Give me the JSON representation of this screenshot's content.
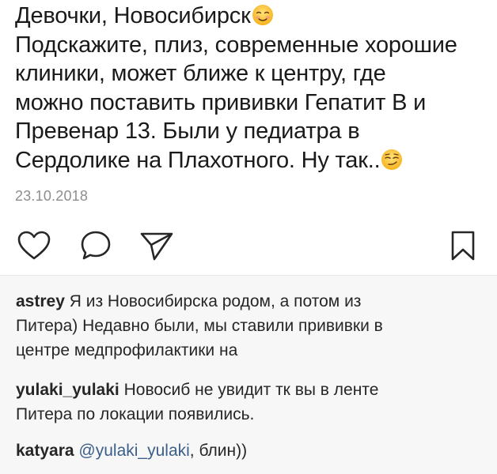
{
  "post": {
    "lines": [
      "Девочки, Новосибирск",
      "Подскажите, плиз, современные хорошие",
      "клиники, может ближе к центру, где",
      "можно поставить прививки Гепатит В и",
      "Превенар 13. Были у педиатра в",
      "Сердолике на Плахотного. Ну так.."
    ],
    "emoji_1": "smiling-face-with-blush",
    "emoji_2": "smirking-face",
    "date": "23.10.2018"
  },
  "actions": {
    "like_icon": "heart-icon",
    "comment_icon": "comment-bubble-icon",
    "share_icon": "paper-plane-icon",
    "save_icon": "bookmark-icon"
  },
  "comments": [
    {
      "username": "astrey",
      "lines": [
        "Я из Новосибирска родом, а потом из",
        "Питера) Недавно были, мы ставили прививки в",
        "центре медпрофилактики на"
      ]
    },
    {
      "username": "yulaki_yulaki",
      "lines": [
        "Новосиб не увидит тк вы в ленте",
        "Питера по локации появились."
      ]
    },
    {
      "username": "katyara",
      "mention": "@yulaki_yulaki",
      "rest": ", блин))"
    }
  ],
  "colors": {
    "text": "#262626",
    "date": "#8e8e8e",
    "mention": "#3b5f8a",
    "comments_bg": "#f7f7f7"
  }
}
